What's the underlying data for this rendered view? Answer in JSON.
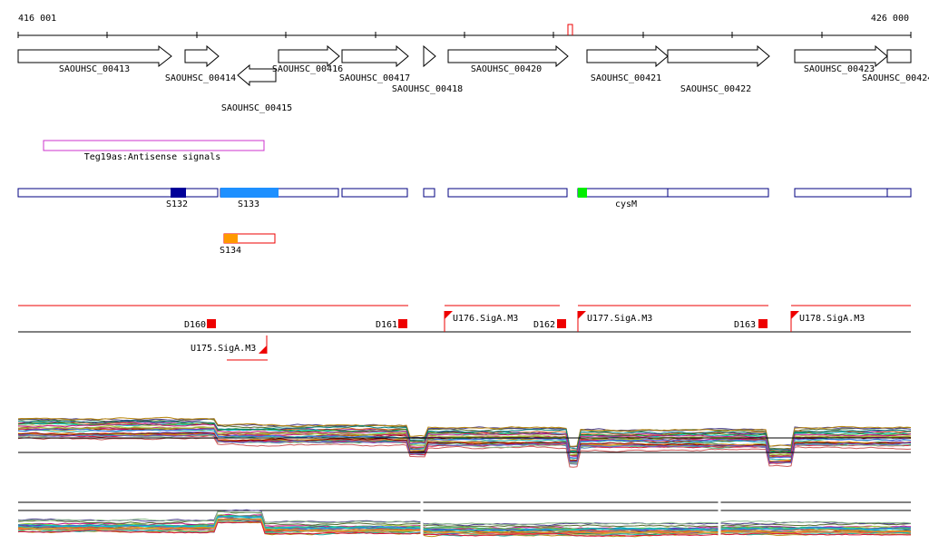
{
  "ruler": {
    "start_label": "416 001",
    "end_label": "426 000"
  },
  "genes": {
    "labels": [
      "SAOUHSC_00413",
      "SAOUHSC_00414",
      "SAOUHSC_00415",
      "SAOUHSC_00416",
      "SAOUHSC_00417",
      "SAOUHSC_00418",
      "SAOUHSC_00420",
      "SAOUHSC_00421",
      "SAOUHSC_00422",
      "SAOUHSC_00423",
      "SAOUHSC_00424"
    ]
  },
  "antisense": {
    "label": "Teg19as:Antisense signals"
  },
  "segments": {
    "labels": [
      "S132",
      "S133",
      "cysM",
      "S134"
    ]
  },
  "transcripts": {
    "labels": [
      "D160",
      "D161",
      "U176.SigA.M3",
      "D162",
      "U177.SigA.M3",
      "D163",
      "U178.SigA.M3",
      "U175.SigA.M3"
    ]
  },
  "colors": {
    "gene_outline": "#000000",
    "antisense": "#cc33cc",
    "segment_outline": "#000080",
    "segment_dark": "#000099",
    "segment_blue": "#1e90ff",
    "segment_green": "#00ee00",
    "segment_orange": "#ff9900",
    "feature_red": "#ee0000"
  }
}
